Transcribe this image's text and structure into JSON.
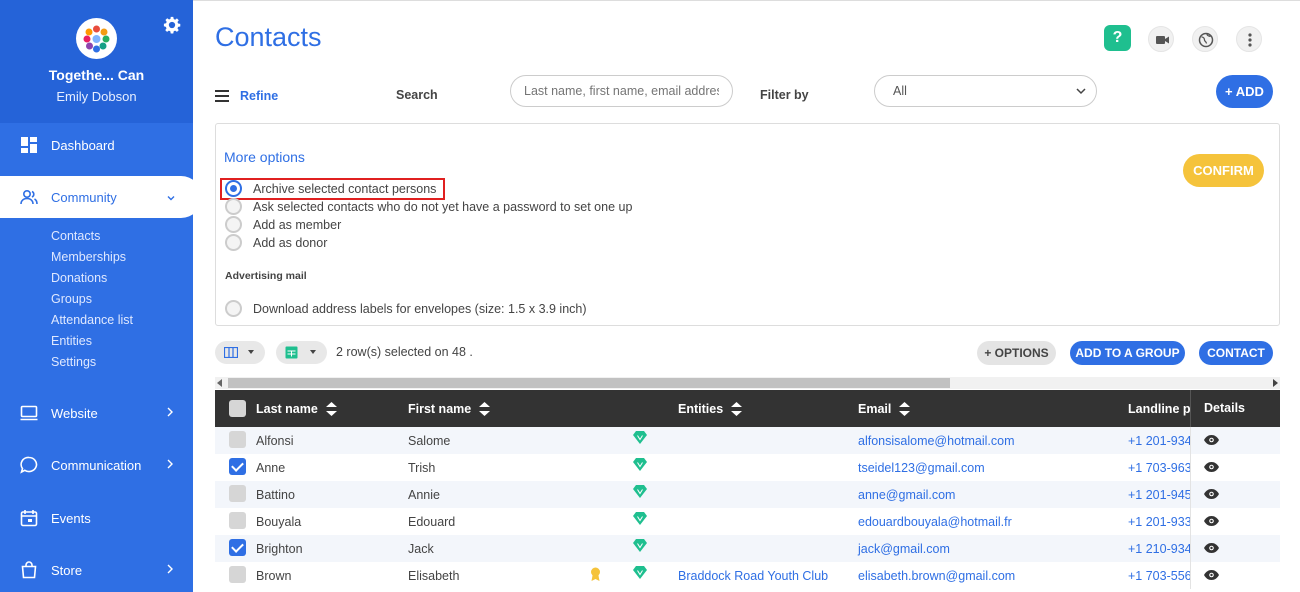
{
  "sidebar": {
    "org_name": "Togethe... Can",
    "user_name": "Emily Dobson",
    "nav": [
      {
        "label": "Dashboard"
      },
      {
        "label": "Community"
      },
      {
        "label": "Website"
      },
      {
        "label": "Communication"
      },
      {
        "label": "Events"
      },
      {
        "label": "Store"
      }
    ],
    "community_sub": [
      "Contacts",
      "Memberships",
      "Donations",
      "Groups",
      "Attendance list",
      "Entities",
      "Settings"
    ]
  },
  "header": {
    "title": "Contacts",
    "help": "?"
  },
  "filters": {
    "refine": "Refine",
    "search_label": "Search",
    "search_placeholder": "Last name, first name, email address",
    "filter_label": "Filter by",
    "filter_value": "All",
    "add_button": "+ ADD"
  },
  "options": {
    "more_options": "More options",
    "confirm": "CONFIRM",
    "radios": [
      {
        "label": "Archive selected contact persons",
        "checked": true
      },
      {
        "label": "Ask selected contacts who do not yet have a password to set one up",
        "checked": false
      },
      {
        "label": "Add as member",
        "checked": false
      },
      {
        "label": "Add as donor",
        "checked": false
      }
    ],
    "advertising_mail": "Advertising mail",
    "download_labels": "Download address labels for envelopes (size: 1.5 x 3.9 inch)"
  },
  "toolbar": {
    "selected_text": "2 row(s) selected on 48 .",
    "options_button": "+ OPTIONS",
    "add_group_button": "ADD TO A GROUP",
    "contact_button": "CONTACT"
  },
  "table": {
    "headers": {
      "last_name": "Last name",
      "first_name": "First name",
      "entities": "Entities",
      "email": "Email",
      "landline": "Landline phone",
      "details": "Details"
    },
    "rows": [
      {
        "last": "Alfonsi",
        "first": "Salome",
        "entity": "",
        "email": "alfonsisalome@hotmail.com",
        "phone": "+1 201-934",
        "checked": false,
        "award": false
      },
      {
        "last": "Anne",
        "first": "Trish",
        "entity": "",
        "email": "tseidel123@gmail.com",
        "phone": "+1 703-963",
        "checked": true,
        "award": false
      },
      {
        "last": "Battino",
        "first": "Annie",
        "entity": "",
        "email": "anne@gmail.com",
        "phone": "+1 201-945",
        "checked": false,
        "award": false
      },
      {
        "last": "Bouyala",
        "first": "Edouard",
        "entity": "",
        "email": "edouardbouyala@hotmail.fr",
        "phone": "+1 201-933",
        "checked": false,
        "award": false
      },
      {
        "last": "Brighton",
        "first": "Jack",
        "entity": "",
        "email": "jack@gmail.com",
        "phone": "+1 210-934",
        "checked": true,
        "award": false
      },
      {
        "last": "Brown",
        "first": "Elisabeth",
        "entity": "Braddock Road Youth Club",
        "email": "elisabeth.brown@gmail.com",
        "phone": "+1 703-556",
        "checked": false,
        "award": true
      }
    ]
  },
  "colors": {
    "primary": "#2f6fe4",
    "sidebar_top": "#2563d8",
    "confirm": "#f5c33b",
    "help": "#1fbf8f",
    "gem": "#1fbf8f",
    "award": "#f5c33b",
    "highlight": "#e02020"
  }
}
